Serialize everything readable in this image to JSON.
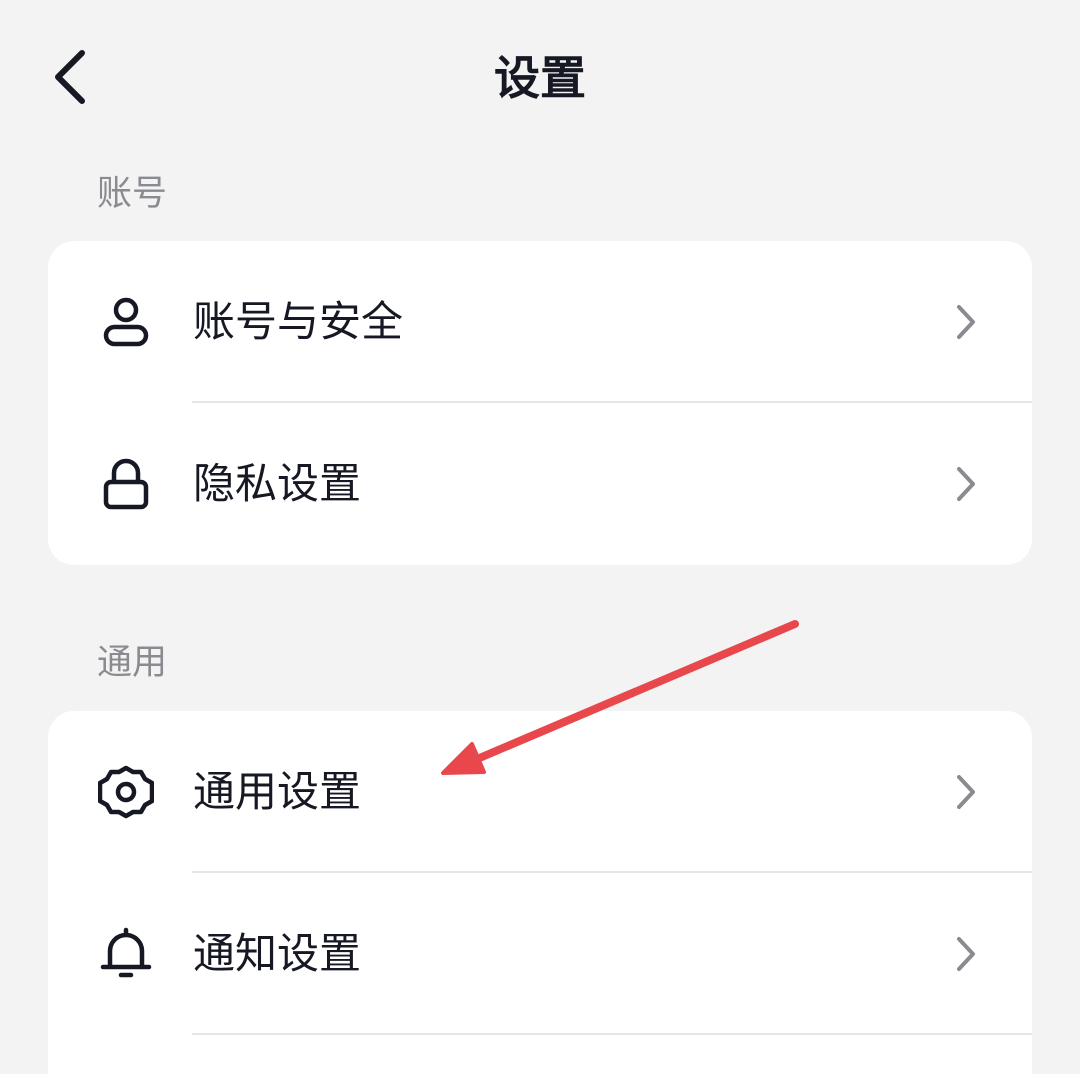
{
  "header": {
    "title": "设置"
  },
  "sections": [
    {
      "label": "账号",
      "items": [
        {
          "label": "账号与安全",
          "icon": "user-icon"
        },
        {
          "label": "隐私设置",
          "icon": "lock-icon"
        }
      ]
    },
    {
      "label": "通用",
      "items": [
        {
          "label": "通用设置",
          "icon": "gear-icon"
        },
        {
          "label": "通知设置",
          "icon": "bell-icon"
        }
      ]
    }
  ],
  "colors": {
    "background": "#f3f3f3",
    "card": "#ffffff",
    "text": "#161823",
    "secondary_text": "#8a8b91",
    "chevron": "#8a8b91",
    "annotation_arrow": "#e8474c"
  }
}
